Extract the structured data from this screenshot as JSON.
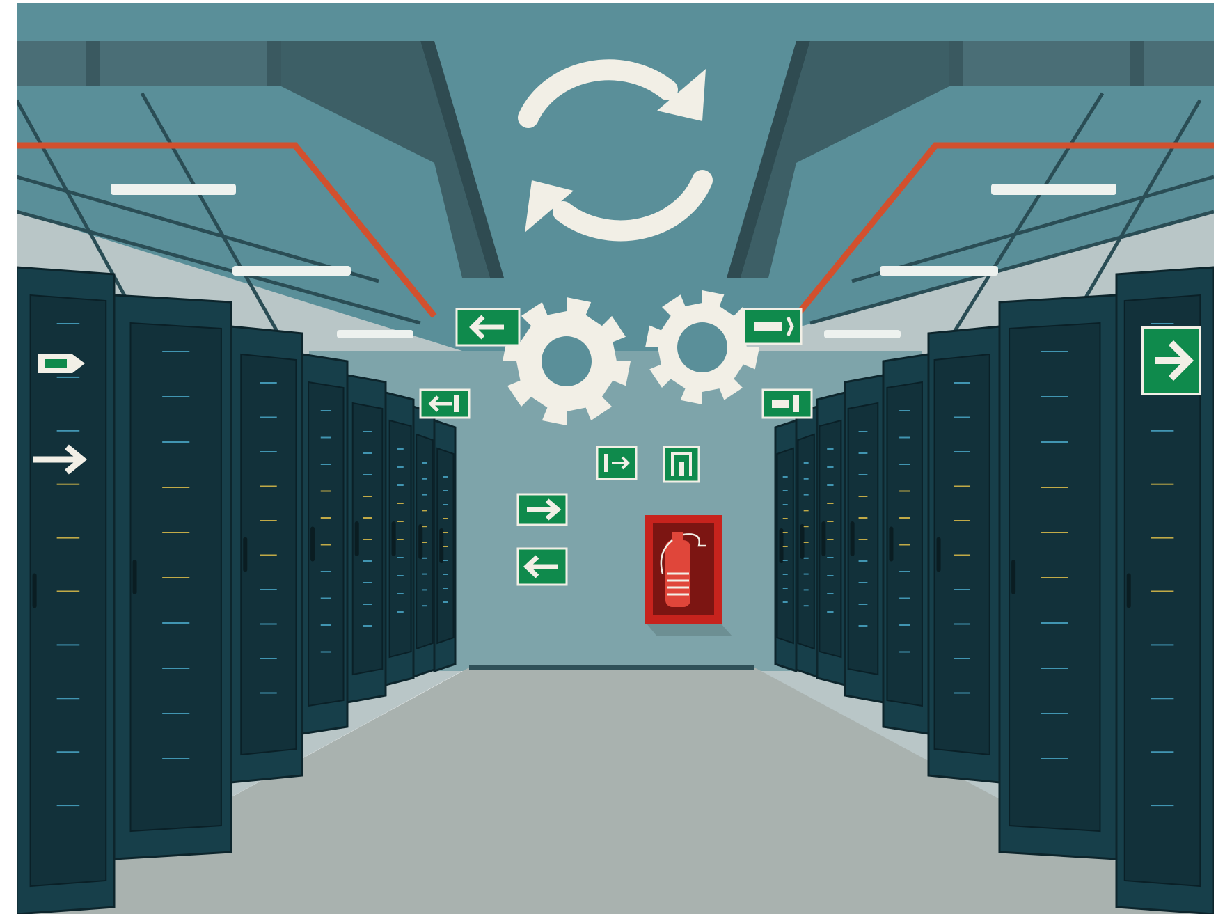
{
  "scene": "server-room-maintenance-illustration",
  "colors": {
    "ceiling": "#5a8f99",
    "back_wall": "#7ea4aa",
    "side_wall": "#b9c6c7",
    "floor": "#a9b2af",
    "rack": "#173f4a",
    "rack_door": "#12313a",
    "duct": "#4a6e76",
    "duct_dark": "#3a5960",
    "pipe": "#d2502e",
    "light": "#eef2ef",
    "sign_green": "#0f8a4c",
    "symbol": "#f2efe6",
    "extinguisher_box": "#c7231d",
    "led_yellow": "#e0c04a",
    "led_blue": "#4aa7c7"
  },
  "icons": {
    "sync": "sync-arrows-icon",
    "gears": "gears-icon",
    "exit_signs": "exit-sign-icon",
    "extinguisher": "fire-extinguisher-icon"
  }
}
